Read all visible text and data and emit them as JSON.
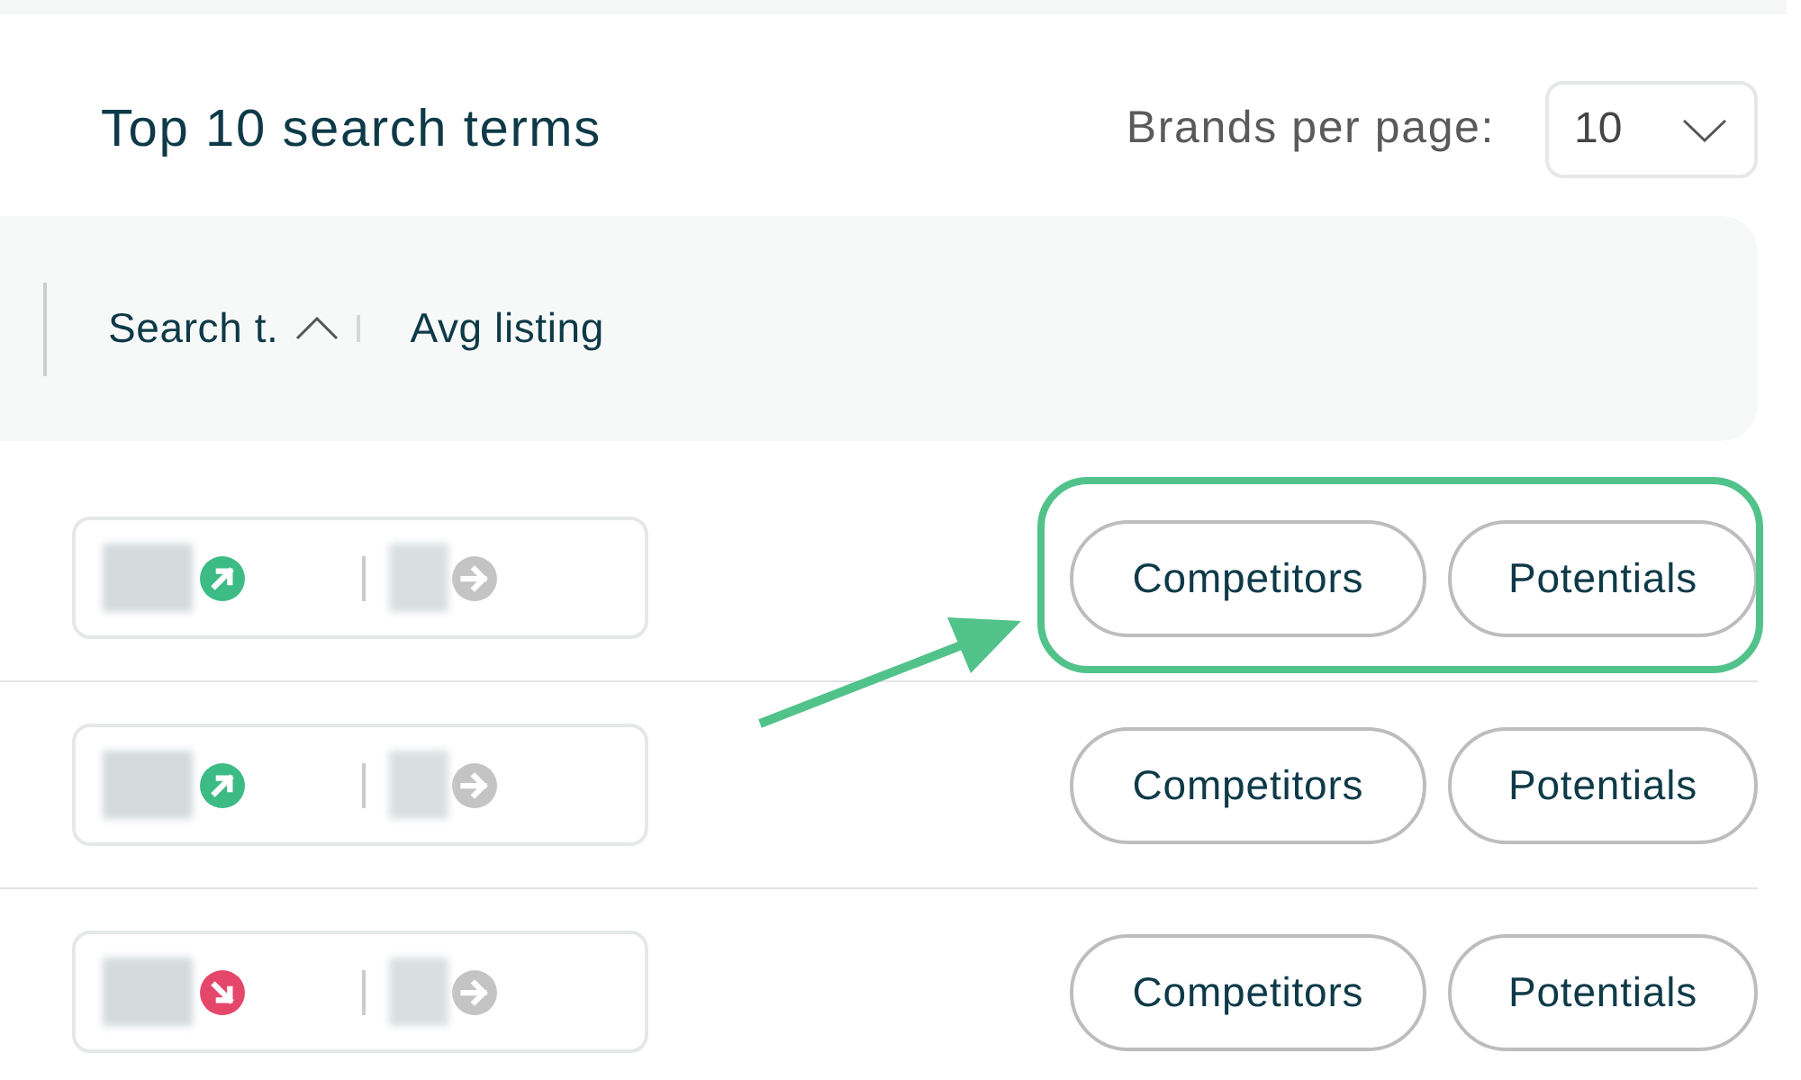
{
  "header": {
    "title": "Top 10 search terms",
    "page_size_label": "Brands per page:",
    "page_size": {
      "value": "10"
    }
  },
  "table": {
    "columns": [
      {
        "label": "Search t.",
        "sorted": true
      },
      {
        "label": "Avg listing",
        "sorted": false
      }
    ],
    "rows": [
      {
        "metrics": [
          {
            "kind": "up"
          },
          {
            "kind": "flat"
          }
        ],
        "actions": [
          {
            "label": "Competitors"
          },
          {
            "label": "Potentials"
          }
        ],
        "highlighted": true
      },
      {
        "metrics": [
          {
            "kind": "up"
          },
          {
            "kind": "flat"
          }
        ],
        "actions": [
          {
            "label": "Competitors"
          },
          {
            "label": "Potentials"
          }
        ],
        "highlighted": false
      },
      {
        "metrics": [
          {
            "kind": "down"
          },
          {
            "kind": "flat"
          }
        ],
        "actions": [
          {
            "label": "Competitors"
          },
          {
            "label": "Potentials"
          }
        ],
        "highlighted": false
      }
    ]
  }
}
